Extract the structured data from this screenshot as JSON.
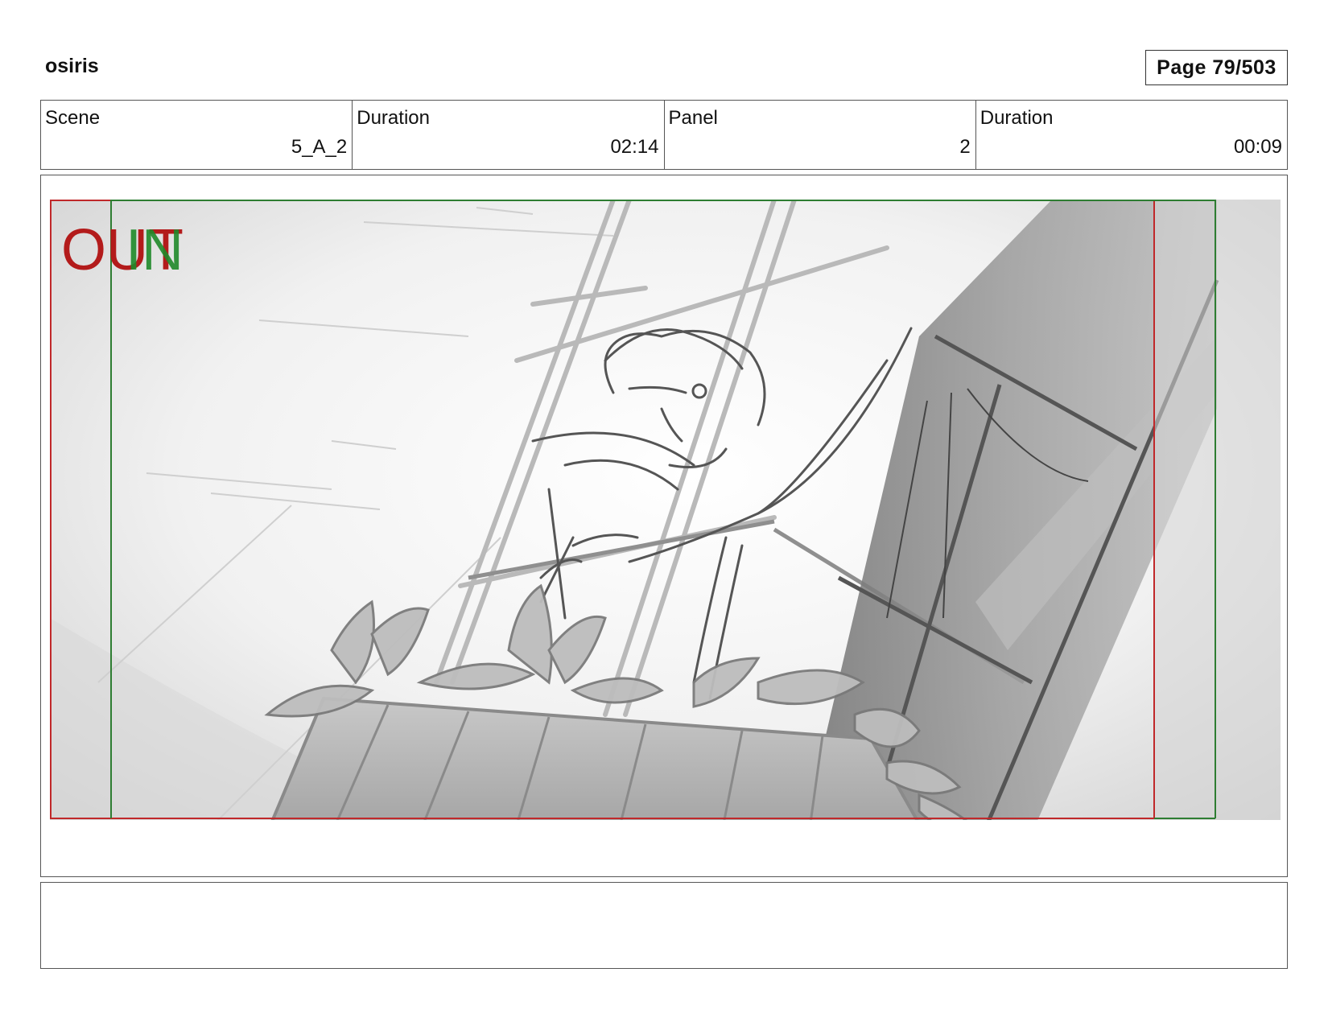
{
  "header": {
    "project_title": "osiris",
    "page_counter": "Page 79/503"
  },
  "info": {
    "scene_label": "Scene",
    "scene_value": "5_A_2",
    "scene_duration_label": "Duration",
    "scene_duration_value": "02:14",
    "panel_label": "Panel",
    "panel_value": "2",
    "panel_duration_label": "Duration",
    "panel_duration_value": "00:09"
  },
  "panel": {
    "out_label": "OUT",
    "in_label": "IN",
    "out_color": "#b31b1b",
    "in_color": "#1f8a2a",
    "safe_frame_out_color": "#c0282a",
    "safe_frame_in_color": "#2e7d32"
  },
  "notes": {
    "text": ""
  }
}
